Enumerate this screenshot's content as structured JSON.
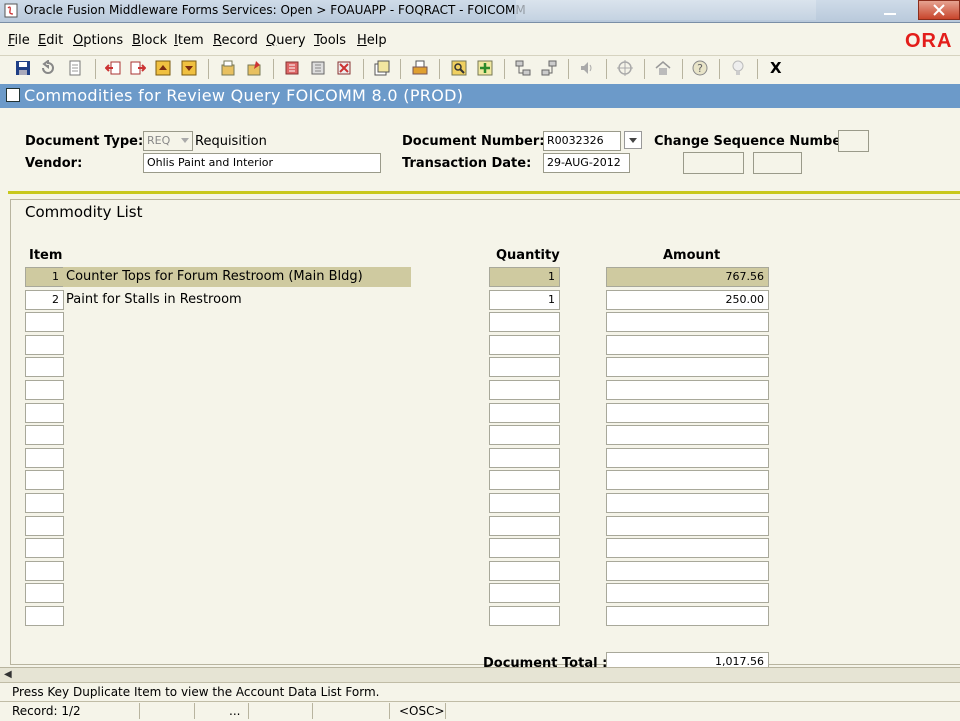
{
  "window": {
    "title": "Oracle Fusion Middleware Forms Services:  Open > FOAUAPP - FOQRACT - FOICOMM"
  },
  "menu": [
    "File",
    "Edit",
    "Options",
    "Block",
    "Item",
    "Record",
    "Query",
    "Tools",
    "Help"
  ],
  "brand": {
    "logo_text": "ORA",
    "color": "#e31d1a"
  },
  "toolbar": {
    "exit_label": "X"
  },
  "form": {
    "title": "Commodities for Review Query  FOICOMM  8.0  (PROD)"
  },
  "key_block": {
    "document_type_label": "Document Type:",
    "document_type_code": "REQ",
    "document_type_desc": "Requisition",
    "document_number_label": "Document Number:",
    "document_number": "R0032326",
    "change_sequence_label": "Change Sequence Number:",
    "change_sequence": "",
    "vendor_label": "Vendor:",
    "vendor": "Ohlis Paint and Interior",
    "transaction_date_label": "Transaction Date:",
    "transaction_date": "29-AUG-2012"
  },
  "commodity": {
    "title": "Commodity List",
    "headers": {
      "item": "Item",
      "quantity": "Quantity",
      "amount": "Amount"
    },
    "rows": [
      {
        "item": "1",
        "description": "Counter Tops for Forum Restroom (Main Bldg)",
        "quantity": "1",
        "amount": "767.56"
      },
      {
        "item": "2",
        "description": "Paint for Stalls in Restroom",
        "quantity": "1",
        "amount": "250.00"
      },
      {
        "item": "",
        "description": "",
        "quantity": "",
        "amount": ""
      },
      {
        "item": "",
        "description": "",
        "quantity": "",
        "amount": ""
      },
      {
        "item": "",
        "description": "",
        "quantity": "",
        "amount": ""
      },
      {
        "item": "",
        "description": "",
        "quantity": "",
        "amount": ""
      },
      {
        "item": "",
        "description": "",
        "quantity": "",
        "amount": ""
      },
      {
        "item": "",
        "description": "",
        "quantity": "",
        "amount": ""
      },
      {
        "item": "",
        "description": "",
        "quantity": "",
        "amount": ""
      },
      {
        "item": "",
        "description": "",
        "quantity": "",
        "amount": ""
      },
      {
        "item": "",
        "description": "",
        "quantity": "",
        "amount": ""
      },
      {
        "item": "",
        "description": "",
        "quantity": "",
        "amount": ""
      },
      {
        "item": "",
        "description": "",
        "quantity": "",
        "amount": ""
      },
      {
        "item": "",
        "description": "",
        "quantity": "",
        "amount": ""
      },
      {
        "item": "",
        "description": "",
        "quantity": "",
        "amount": ""
      },
      {
        "item": "",
        "description": "",
        "quantity": "",
        "amount": ""
      }
    ],
    "document_total_label": "Document Total :",
    "document_total": "1,017.56"
  },
  "status": {
    "hint": "Press Key Duplicate Item to view the Account Data List Form.",
    "record": "Record: 1/2",
    "ellipsis": "...",
    "mode": "<OSC>"
  },
  "colors": {
    "title_blue": "#6c9ac9",
    "selected_row": "#cfcaa0",
    "divider": "#c8c81e"
  }
}
